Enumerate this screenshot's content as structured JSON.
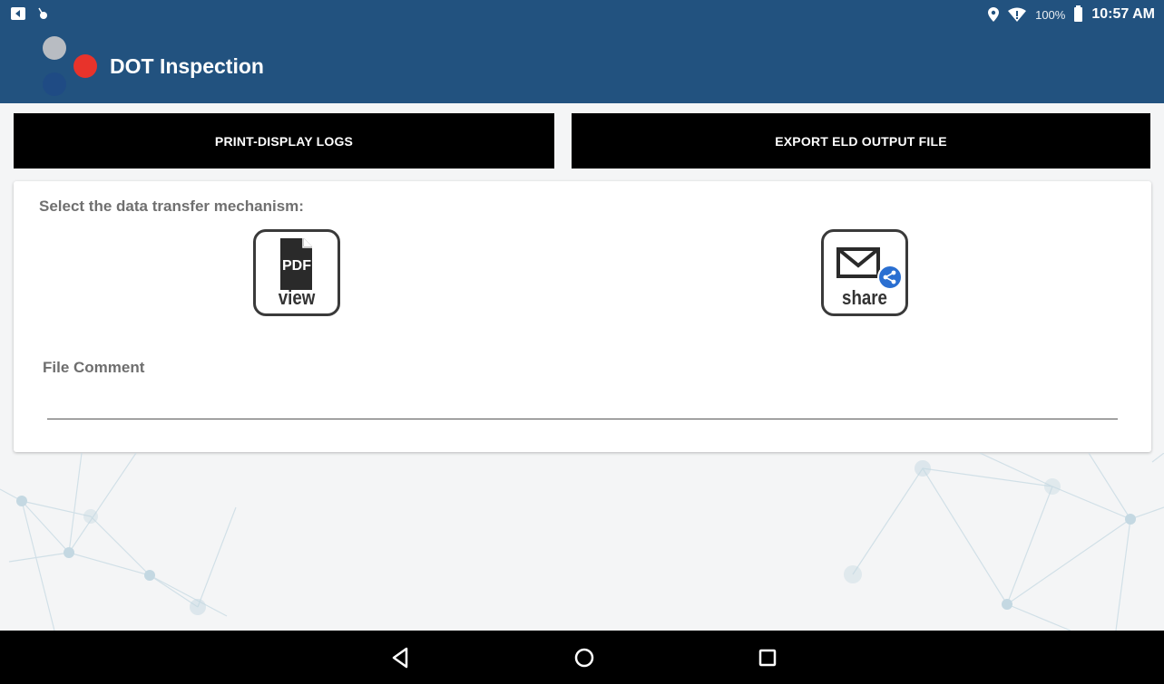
{
  "status_bar": {
    "battery_percent": "100%",
    "time": "10:57 AM",
    "left_icons": [
      "notification-icon",
      "notification-icon-2"
    ],
    "right_icons": [
      "location-icon",
      "wifi-icon",
      "battery-icon"
    ]
  },
  "app_bar": {
    "title": "DOT Inspection",
    "colors": {
      "bar": "#22527f",
      "logo_red": "#e8332b",
      "logo_gray": "#b8bcc2",
      "logo_blue": "#1f4b84"
    }
  },
  "actions": {
    "print_label": "PRINT-DISPLAY LOGS",
    "export_label": "EXPORT ELD OUTPUT FILE"
  },
  "transfer": {
    "prompt": "Select the data transfer mechanism:",
    "pdf_badge": "PDF",
    "pdf_caption": "view",
    "share_caption": "share"
  },
  "file_comment": {
    "label": "File Comment",
    "value": "",
    "placeholder": ""
  },
  "nav_bar": {
    "icons": [
      "back-icon",
      "home-icon",
      "recents-icon"
    ]
  }
}
